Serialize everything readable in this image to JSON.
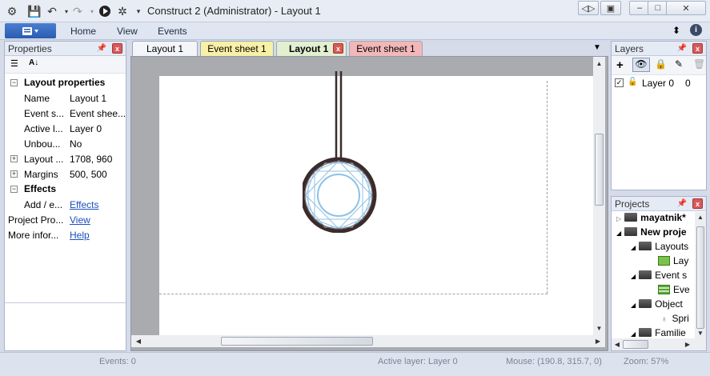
{
  "window": {
    "title": "Construct 2 (Administrator) - Layout 1"
  },
  "ribbon": {
    "tabs": [
      "Home",
      "View",
      "Events"
    ]
  },
  "properties": {
    "header": "Properties",
    "section_layout": "Layout properties",
    "rows": [
      {
        "name": "Name",
        "value": "Layout 1"
      },
      {
        "name": "Event s...",
        "value": "Event shee..."
      },
      {
        "name": "Active l...",
        "value": "Layer 0"
      },
      {
        "name": "Unbou...",
        "value": "No"
      },
      {
        "name": "Layout ...",
        "value": "1708, 960"
      },
      {
        "name": "Margins",
        "value": "500, 500"
      }
    ],
    "section_effects": "Effects",
    "add_effect_name": "Add / e...",
    "add_effect_link": "Effects",
    "project_props_name": "Project Pro...",
    "project_props_link": "View",
    "more_info_name": "More infor...",
    "more_info_link": "Help"
  },
  "doc_tabs": [
    {
      "label": "Layout 1",
      "color": "#f3f5f9"
    },
    {
      "label": "Event sheet 1",
      "color": "#f7f0a6"
    },
    {
      "label": "Layout 1",
      "color": "#e2f0cf",
      "active": true
    },
    {
      "label": "Event sheet 1",
      "color": "#f2b8b8"
    }
  ],
  "layers": {
    "header": "Layers",
    "items": [
      {
        "name": "Layer 0",
        "index": "0",
        "checked": true
      }
    ]
  },
  "projects": {
    "header": "Projects",
    "items": [
      {
        "label": "mayatnik*",
        "bold": true
      },
      {
        "label": "New proje",
        "bold": true
      },
      {
        "label": "Layouts"
      },
      {
        "label": "Lay"
      },
      {
        "label": "Event s"
      },
      {
        "label": "Eve"
      },
      {
        "label": "Object"
      },
      {
        "label": "Spri"
      },
      {
        "label": "Familie"
      }
    ]
  },
  "status": {
    "events": "Events: 0",
    "active_layer": "Active layer: Layer 0",
    "mouse": "Mouse: (190.8, 315.7, 0)",
    "zoom": "Zoom: 57%"
  },
  "colors": {
    "accent": "#2a5bb0",
    "canvas_bg": "#a9abaf",
    "layout_bg": "#ffffff",
    "close_red": "#d85a5a"
  }
}
